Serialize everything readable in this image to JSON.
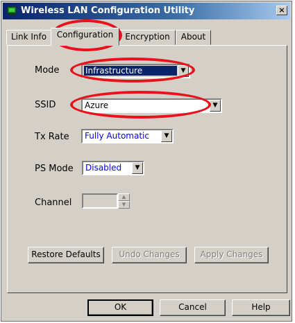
{
  "window": {
    "title": "Wireless LAN Configuration Utility",
    "close_label": "×",
    "icon": "network-adapter-icon"
  },
  "tabs": [
    {
      "label": "Link Info",
      "active": false
    },
    {
      "label": "Configuration",
      "active": true
    },
    {
      "label": "Encryption",
      "active": false
    },
    {
      "label": "About",
      "active": false
    }
  ],
  "form": {
    "mode": {
      "label": "Mode",
      "value": "Infrastructure"
    },
    "ssid": {
      "label": "SSID",
      "value": "Azure"
    },
    "tx_rate": {
      "label": "Tx Rate",
      "value": "Fully Automatic"
    },
    "ps_mode": {
      "label": "PS Mode",
      "value": "Disabled"
    },
    "channel": {
      "label": "Channel",
      "value": ""
    }
  },
  "buttons": {
    "restore_defaults": "Restore Defaults",
    "undo_changes": "Undo Changes",
    "apply_changes": "Apply Changes",
    "ok": "OK",
    "cancel": "Cancel",
    "help": "Help"
  },
  "colors": {
    "titlebar": "#0a246a",
    "selection": "#0a246a",
    "annotation": "#e8121c",
    "value_text": "#0000ff"
  }
}
